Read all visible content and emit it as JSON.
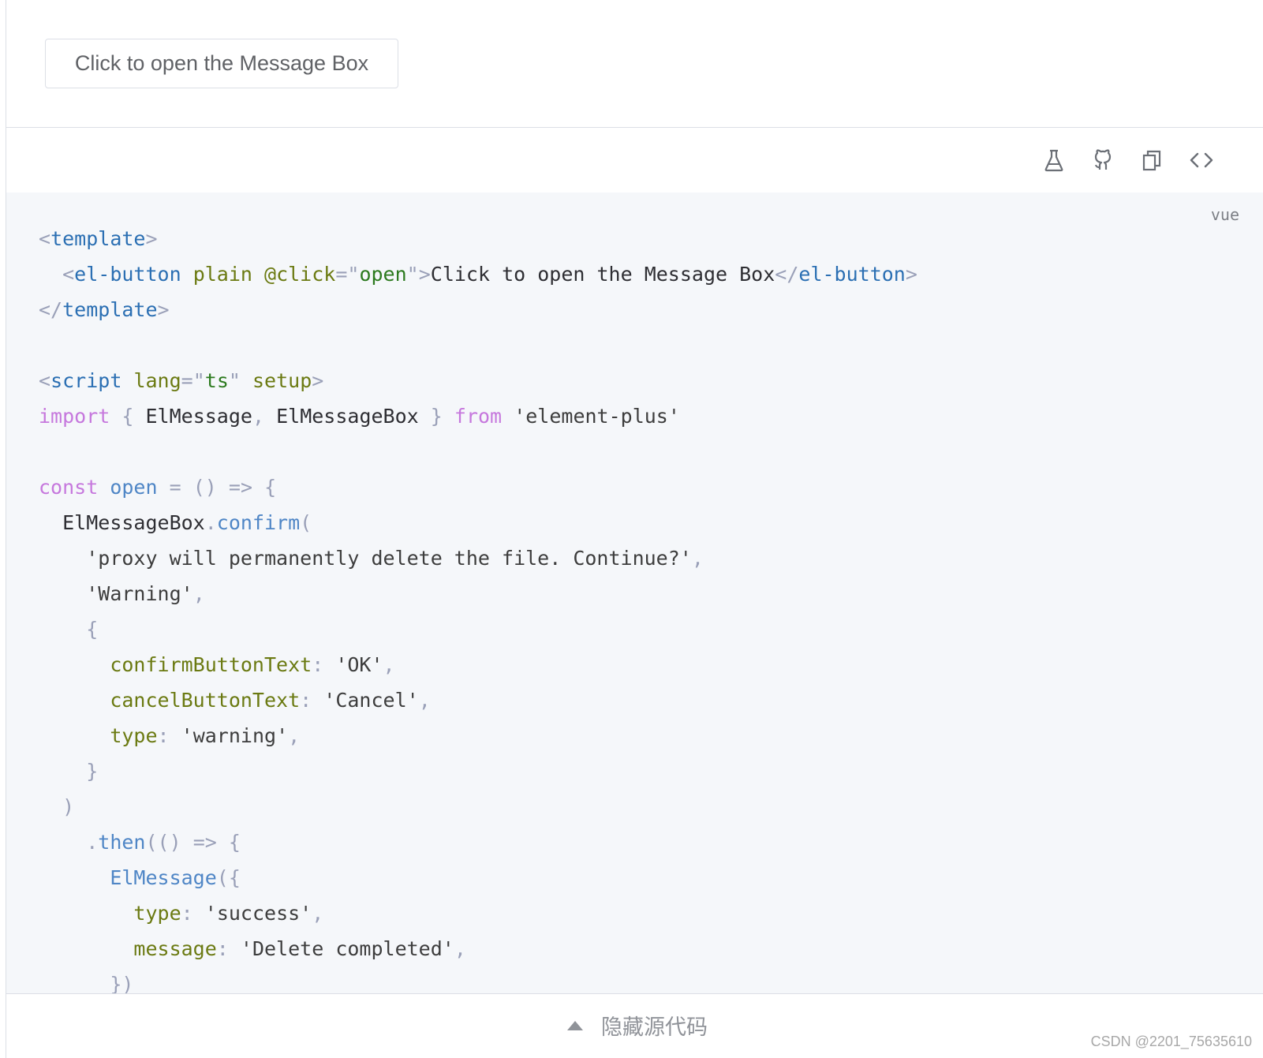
{
  "demo": {
    "button_label": "Click to open the Message Box"
  },
  "toolbar": {
    "icons": [
      "flask-icon",
      "github-icon",
      "copy-icon",
      "code-icon"
    ]
  },
  "code": {
    "language": "vue",
    "lines": [
      [
        [
          "t-punc",
          "<"
        ],
        [
          "t-tag",
          "template"
        ],
        [
          "t-punc",
          ">"
        ]
      ],
      [
        [
          "t-text",
          "  "
        ],
        [
          "t-punc",
          "<"
        ],
        [
          "t-tag",
          "el-button"
        ],
        [
          "t-text",
          " "
        ],
        [
          "t-attr",
          "plain"
        ],
        [
          "t-text",
          " "
        ],
        [
          "t-attr",
          "@click"
        ],
        [
          "t-punc",
          "=\""
        ],
        [
          "t-str",
          "open"
        ],
        [
          "t-punc",
          "\">"
        ],
        [
          "t-text",
          "Click to open the Message Box"
        ],
        [
          "t-punc",
          "</"
        ],
        [
          "t-tag",
          "el-button"
        ],
        [
          "t-punc",
          ">"
        ]
      ],
      [
        [
          "t-punc",
          "</"
        ],
        [
          "t-tag",
          "template"
        ],
        [
          "t-punc",
          ">"
        ]
      ],
      [],
      [
        [
          "t-punc",
          "<"
        ],
        [
          "t-tag",
          "script"
        ],
        [
          "t-text",
          " "
        ],
        [
          "t-attr",
          "lang"
        ],
        [
          "t-punc",
          "=\""
        ],
        [
          "t-str",
          "ts"
        ],
        [
          "t-punc",
          "\""
        ],
        [
          "t-text",
          " "
        ],
        [
          "t-attr",
          "setup"
        ],
        [
          "t-punc",
          ">"
        ]
      ],
      [
        [
          "t-kw",
          "import"
        ],
        [
          "t-text",
          " "
        ],
        [
          "t-punc",
          "{"
        ],
        [
          "t-text",
          " "
        ],
        [
          "t-id",
          "ElMessage"
        ],
        [
          "t-punc",
          ","
        ],
        [
          "t-text",
          " "
        ],
        [
          "t-id",
          "ElMessageBox"
        ],
        [
          "t-text",
          " "
        ],
        [
          "t-punc",
          "}"
        ],
        [
          "t-text",
          " "
        ],
        [
          "t-kw",
          "from"
        ],
        [
          "t-text",
          " "
        ],
        [
          "t-strlit",
          "'element-plus'"
        ]
      ],
      [],
      [
        [
          "t-kw",
          "const"
        ],
        [
          "t-text",
          " "
        ],
        [
          "t-fn",
          "open"
        ],
        [
          "t-text",
          " "
        ],
        [
          "t-punc",
          "="
        ],
        [
          "t-text",
          " "
        ],
        [
          "t-punc",
          "()"
        ],
        [
          "t-text",
          " "
        ],
        [
          "t-punc",
          "=>"
        ],
        [
          "t-text",
          " "
        ],
        [
          "t-punc",
          "{"
        ]
      ],
      [
        [
          "t-text",
          "  "
        ],
        [
          "t-id",
          "ElMessageBox"
        ],
        [
          "t-punc",
          "."
        ],
        [
          "t-fn",
          "confirm"
        ],
        [
          "t-punc",
          "("
        ]
      ],
      [
        [
          "t-text",
          "    "
        ],
        [
          "t-strlit",
          "'proxy will permanently delete the file. Continue?'"
        ],
        [
          "t-punc",
          ","
        ]
      ],
      [
        [
          "t-text",
          "    "
        ],
        [
          "t-strlit",
          "'Warning'"
        ],
        [
          "t-punc",
          ","
        ]
      ],
      [
        [
          "t-text",
          "    "
        ],
        [
          "t-punc",
          "{"
        ]
      ],
      [
        [
          "t-text",
          "      "
        ],
        [
          "t-prop",
          "confirmButtonText"
        ],
        [
          "t-punc",
          ":"
        ],
        [
          "t-text",
          " "
        ],
        [
          "t-strlit",
          "'OK'"
        ],
        [
          "t-punc",
          ","
        ]
      ],
      [
        [
          "t-text",
          "      "
        ],
        [
          "t-prop",
          "cancelButtonText"
        ],
        [
          "t-punc",
          ":"
        ],
        [
          "t-text",
          " "
        ],
        [
          "t-strlit",
          "'Cancel'"
        ],
        [
          "t-punc",
          ","
        ]
      ],
      [
        [
          "t-text",
          "      "
        ],
        [
          "t-prop",
          "type"
        ],
        [
          "t-punc",
          ":"
        ],
        [
          "t-text",
          " "
        ],
        [
          "t-strlit",
          "'warning'"
        ],
        [
          "t-punc",
          ","
        ]
      ],
      [
        [
          "t-text",
          "    "
        ],
        [
          "t-punc",
          "}"
        ]
      ],
      [
        [
          "t-text",
          "  "
        ],
        [
          "t-punc",
          ")"
        ]
      ],
      [
        [
          "t-text",
          "    "
        ],
        [
          "t-punc",
          "."
        ],
        [
          "t-fn",
          "then"
        ],
        [
          "t-punc",
          "(()"
        ],
        [
          "t-text",
          " "
        ],
        [
          "t-punc",
          "=>"
        ],
        [
          "t-text",
          " "
        ],
        [
          "t-punc",
          "{"
        ]
      ],
      [
        [
          "t-text",
          "      "
        ],
        [
          "t-fn",
          "ElMessage"
        ],
        [
          "t-punc",
          "({"
        ]
      ],
      [
        [
          "t-text",
          "        "
        ],
        [
          "t-prop",
          "type"
        ],
        [
          "t-punc",
          ":"
        ],
        [
          "t-text",
          " "
        ],
        [
          "t-strlit",
          "'success'"
        ],
        [
          "t-punc",
          ","
        ]
      ],
      [
        [
          "t-text",
          "        "
        ],
        [
          "t-prop",
          "message"
        ],
        [
          "t-punc",
          ":"
        ],
        [
          "t-text",
          " "
        ],
        [
          "t-strlit",
          "'Delete completed'"
        ],
        [
          "t-punc",
          ","
        ]
      ],
      [
        [
          "t-text",
          "      "
        ],
        [
          "t-punc",
          "})"
        ]
      ]
    ]
  },
  "footer": {
    "toggle_label": "隐藏源代码"
  },
  "watermark": "CSDN @2201_75635610"
}
